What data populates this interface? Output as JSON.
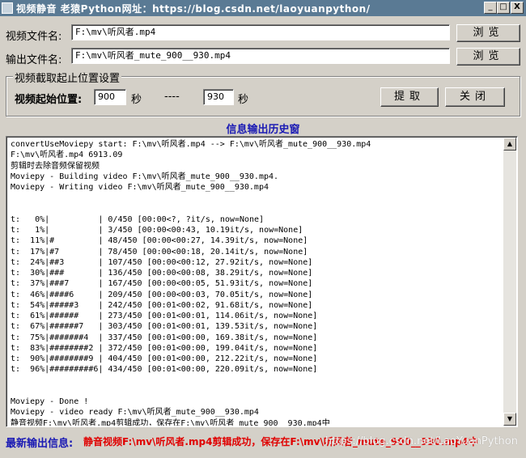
{
  "window": {
    "title": "视频静音    老猿Python网址：https://blog.csdn.net/laoyuanpython/",
    "minimize": "_",
    "maximize": "□",
    "close": "X"
  },
  "video_file": {
    "label": "视频文件名:",
    "value": "F:\\mv\\听风者.mp4",
    "browse": "浏览"
  },
  "output_file": {
    "label": "输出文件名:",
    "value": "F:\\mv\\听风者_mute_900__930.mp4",
    "browse": "浏览"
  },
  "range_group": {
    "legend": "视频截取起止位置设置",
    "start_label": "视频起始位置:",
    "start_value": "900",
    "start_unit": "秒",
    "separator": "----",
    "end_value": "930",
    "end_unit": "秒",
    "extract_button": "提取",
    "close_button": "关闭"
  },
  "log": {
    "title": "信息输出历史窗",
    "lines": [
      "convertUseMoviepy start: F:\\mv\\听风者.mp4 --> F:\\mv\\听风者_mute_900__930.mp4",
      "F:\\mv\\听风者.mp4 6913.09",
      "剪辑时去除音频保留视频",
      "Moviepy - Building video F:\\mv\\听风者_mute_900__930.mp4.",
      "Moviepy - Writing video F:\\mv\\听风者_mute_900__930.mp4",
      "",
      "",
      "t:   0%|          | 0/450 [00:00<?, ?it/s, now=None]",
      "t:   1%|          | 3/450 [00:00<00:43, 10.19it/s, now=None]",
      "t:  11%|#         | 48/450 [00:00<00:27, 14.39it/s, now=None]",
      "t:  17%|#7        | 78/450 [00:00<00:18, 20.14it/s, now=None]",
      "t:  24%|##3       | 107/450 [00:00<00:12, 27.92it/s, now=None]",
      "t:  30%|###       | 136/450 [00:00<00:08, 38.29it/s, now=None]",
      "t:  37%|###7      | 167/450 [00:00<00:05, 51.93it/s, now=None]",
      "t:  46%|####6     | 209/450 [00:00<00:03, 70.05it/s, now=None]",
      "t:  54%|#####3    | 242/450 [00:01<00:02, 91.68it/s, now=None]",
      "t:  61%|######    | 273/450 [00:01<00:01, 114.06it/s, now=None]",
      "t:  67%|######7   | 303/450 [00:01<00:01, 139.53it/s, now=None]",
      "t:  75%|#######4  | 337/450 [00:01<00:00, 169.38it/s, now=None]",
      "t:  83%|########2 | 372/450 [00:01<00:00, 199.04it/s, now=None]",
      "t:  90%|########9 | 404/450 [00:01<00:00, 212.22it/s, now=None]",
      "t:  96%|#########6| 434/450 [00:01<00:00, 220.09it/s, now=None]",
      "",
      "",
      "Moviepy - Done !",
      "Moviepy - video ready F:\\mv\\听风者_mute_900__930.mp4",
      "静音视频F:\\mv\\听风者.mp4剪辑成功，保存在F:\\mv\\听风者_mute_900__930.mp4中"
    ]
  },
  "status": {
    "label": "最新输出信息:",
    "value": "静音视频F:\\mv\\听风者.mp4剪辑成功，保存在F:\\mv\\听风者_mute_900__930.mp4中"
  },
  "watermark": "https://blog.csdn.net/LaoYuanPython"
}
